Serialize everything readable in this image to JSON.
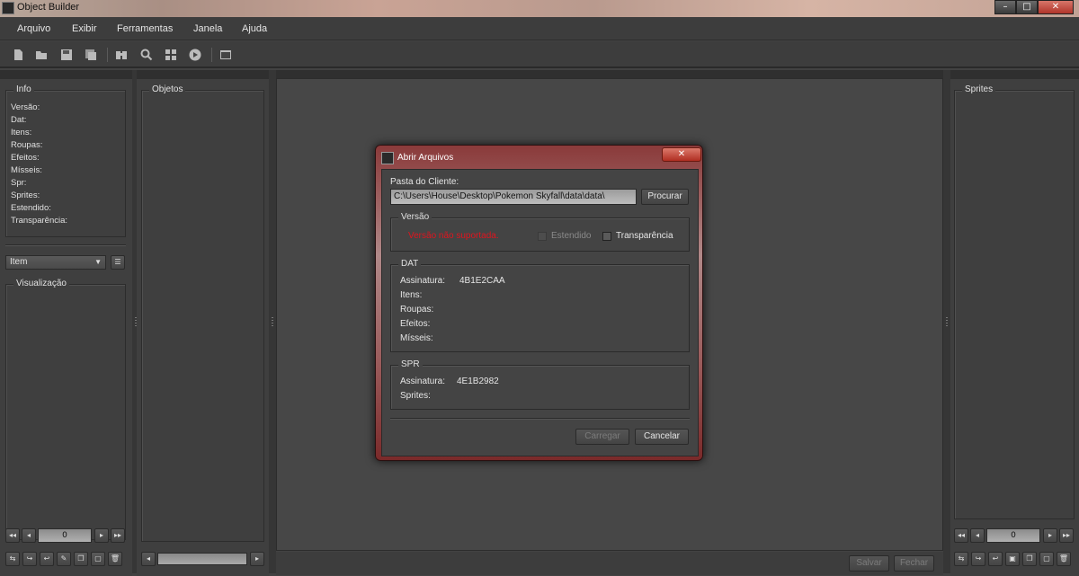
{
  "window": {
    "title": "Object Builder",
    "minimize": "–",
    "maximize": "□",
    "close": "✕"
  },
  "menu": [
    "Arquivo",
    "Exibir",
    "Ferramentas",
    "Janela",
    "Ajuda"
  ],
  "toolbar_icons": [
    "new-file-icon",
    "open-folder-icon",
    "save-icon",
    "save-as-icon",
    "find-icon",
    "search-icon",
    "grid-icon",
    "play-icon",
    "console-icon"
  ],
  "info": {
    "legend": "Info",
    "lines": [
      "Versão:",
      "Dat:",
      "Itens:",
      "Roupas:",
      "Efeitos:",
      "Mísseis:",
      "Spr:",
      "Sprites:",
      "Estendido:",
      "Transparência:"
    ]
  },
  "category_select": "Item",
  "visualization_legend": "Visualização",
  "objects_legend": "Objetos",
  "sprites_legend": "Sprites",
  "left_pager": {
    "value": "0"
  },
  "right_pager": {
    "value": "0"
  },
  "bottom_buttons": {
    "save": "Salvar",
    "close": "Fechar"
  },
  "dialog": {
    "title": "Abrir Arquivos",
    "close": "✕",
    "client_folder_label": "Pasta do Cliente:",
    "client_folder_value": "C:\\Users\\House\\Desktop\\Pokemon Skyfall\\data\\data\\",
    "browse_button": "Procurar",
    "version_legend": "Versão",
    "version_error": "Versão não suportada.",
    "extended_label": "Estendido",
    "transparency_label": "Transparência",
    "dat": {
      "legend": "DAT",
      "signature_label": "Assinatura:",
      "signature_value": "4B1E2CAA",
      "items_label": "Itens:",
      "outfits_label": "Roupas:",
      "effects_label": "Efeitos:",
      "missiles_label": "Mísseis:"
    },
    "spr": {
      "legend": "SPR",
      "signature_label": "Assinatura:",
      "signature_value": "4E1B2982",
      "sprites_label": "Sprites:"
    },
    "load_button": "Carregar",
    "cancel_button": "Cancelar"
  }
}
